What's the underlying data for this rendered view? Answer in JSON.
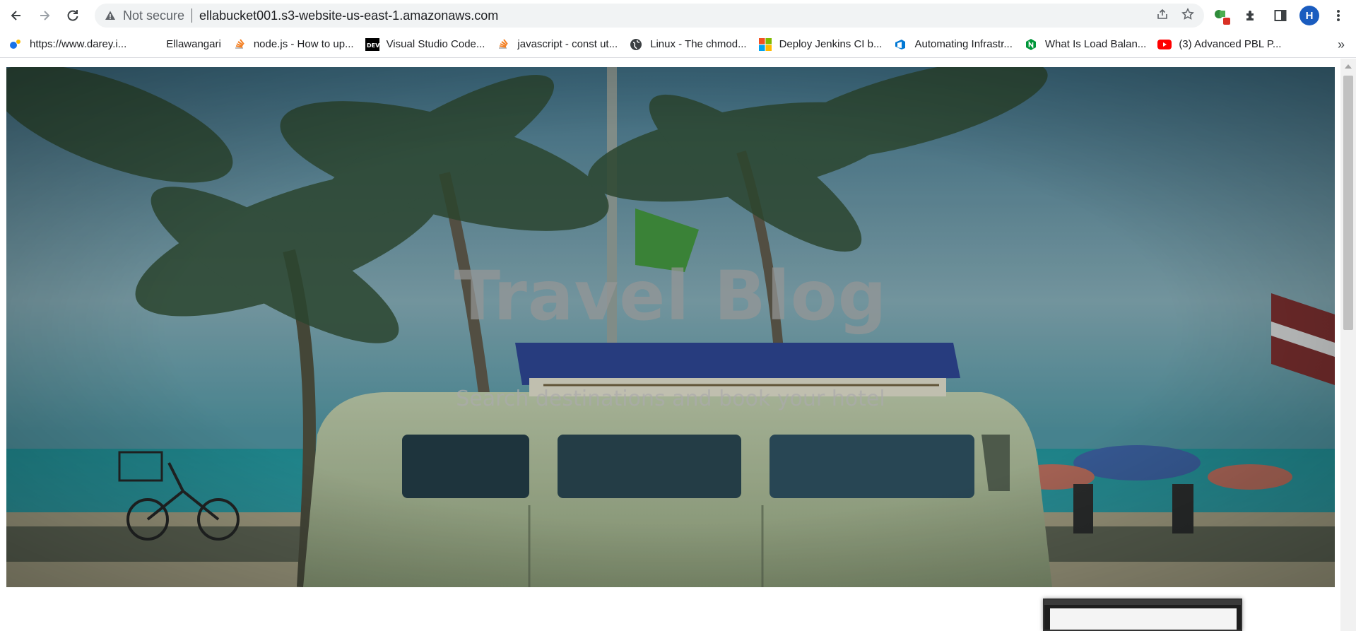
{
  "browser": {
    "security_label": "Not secure",
    "url": "ellabucket001.s3-website-us-east-1.amazonaws.com",
    "profile_initial": "H",
    "accent_color": "#1a5cbf"
  },
  "bookmarks": [
    {
      "label": "https://www.darey.i...",
      "icon": "darey-icon"
    },
    {
      "label": "Ellawangari",
      "icon": "blank-icon"
    },
    {
      "label": "node.js - How to up...",
      "icon": "stackoverflow-icon"
    },
    {
      "label": "Visual Studio Code...",
      "icon": "dev-icon"
    },
    {
      "label": "javascript - const ut...",
      "icon": "stackoverflow-icon"
    },
    {
      "label": "Linux - The chmod...",
      "icon": "globe-icon"
    },
    {
      "label": "Deploy Jenkins CI b...",
      "icon": "microsoft-icon"
    },
    {
      "label": "Automating Infrastr...",
      "icon": "azure-devops-icon"
    },
    {
      "label": "What Is Load Balan...",
      "icon": "nginx-icon"
    },
    {
      "label": "(3) Advanced PBL P...",
      "icon": "youtube-icon"
    }
  ],
  "hero": {
    "title": "Travel Blog",
    "subtitle": "Search destinations and book your hotel"
  }
}
